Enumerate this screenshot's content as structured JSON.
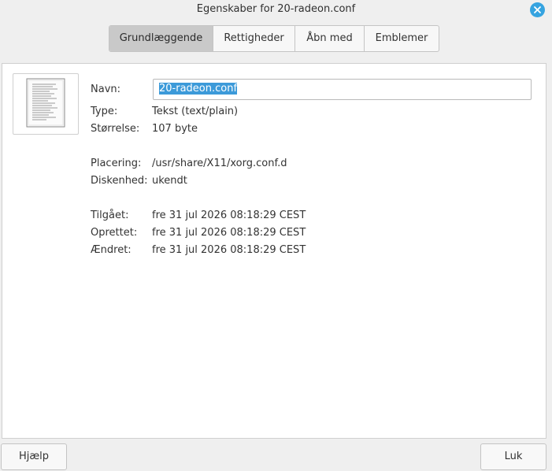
{
  "window": {
    "title": "Egenskaber for 20-radeon.conf"
  },
  "tabs": [
    {
      "label": "Grundlæggende",
      "active": true
    },
    {
      "label": "Rettigheder",
      "active": false
    },
    {
      "label": "Åbn med",
      "active": false
    },
    {
      "label": "Emblemer",
      "active": false
    }
  ],
  "file": {
    "icon": "text-document-icon",
    "name_label": "Navn:",
    "name_value": "20-radeon.conf",
    "type_label": "Type:",
    "type_value": "Tekst (text/plain)",
    "size_label": "Størrelse:",
    "size_value": "107 byte",
    "location_label": "Placering:",
    "location_value": "/usr/share/X11/xorg.conf.d",
    "volume_label": "Diskenhed:",
    "volume_value": "ukendt",
    "accessed_label": "Tilgået:",
    "accessed_value": "fre 31 jul 2026 08:18:29 CEST",
    "created_label": "Oprettet:",
    "created_value": "fre 31 jul 2026 08:18:29 CEST",
    "modified_label": "Ændret:",
    "modified_value": "fre 31 jul 2026 08:18:29 CEST"
  },
  "buttons": {
    "help": "Hjælp",
    "close": "Luk"
  },
  "colors": {
    "accent": "#35a3e0",
    "selection": "#3c9ad9",
    "active_tab": "#c9c9c9"
  }
}
